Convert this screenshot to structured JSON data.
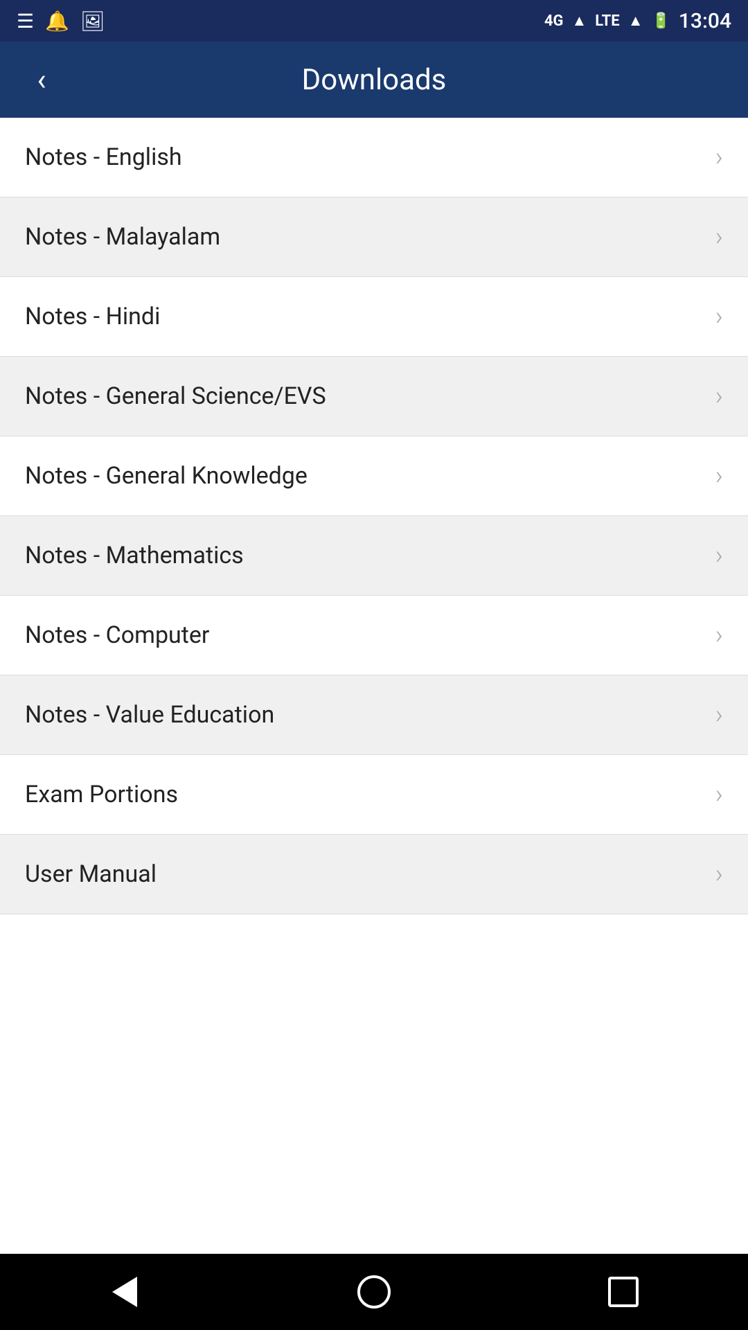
{
  "statusBar": {
    "time": "13:04",
    "networkType": "4G",
    "networkText": "LTE"
  },
  "header": {
    "title": "Downloads",
    "backLabel": "‹"
  },
  "listItems": [
    {
      "id": 1,
      "label": "Notes - English"
    },
    {
      "id": 2,
      "label": "Notes - Malayalam"
    },
    {
      "id": 3,
      "label": "Notes - Hindi"
    },
    {
      "id": 4,
      "label": "Notes - General Science/EVS"
    },
    {
      "id": 5,
      "label": "Notes - General Knowledge"
    },
    {
      "id": 6,
      "label": "Notes - Mathematics"
    },
    {
      "id": 7,
      "label": "Notes - Computer"
    },
    {
      "id": 8,
      "label": "Notes - Value Education"
    },
    {
      "id": 9,
      "label": "Exam Portions"
    },
    {
      "id": 10,
      "label": "User Manual"
    }
  ],
  "bottomNav": {
    "backLabel": "back",
    "homeLabel": "home",
    "recentLabel": "recent"
  }
}
